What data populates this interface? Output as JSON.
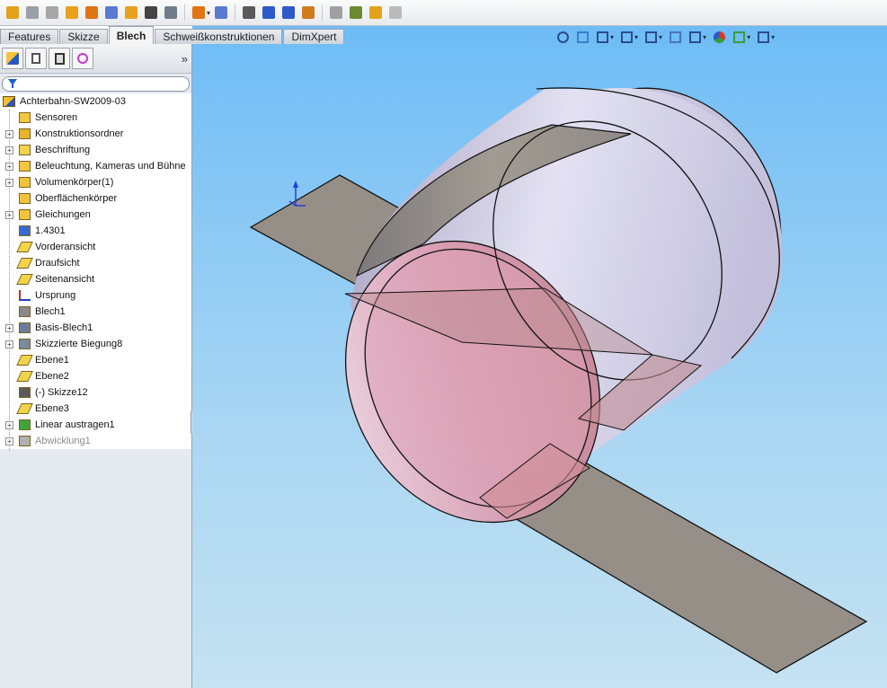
{
  "toolbar": {
    "icons": [
      "sheet-metal-base-icon",
      "convert-to-sheet-metal-icon",
      "lofted-bend-icon",
      "edge-flange-icon",
      "miter-flange-icon",
      "hem-icon",
      "sketched-bend-icon",
      "jog-icon",
      "cross-break-icon",
      "corner-icon",
      "corner-dropdown-icon",
      "closed-corner-icon",
      "forming-tool-icon",
      "unfold-icon",
      "fold-icon",
      "flatten-icon",
      "no-bends-icon",
      "rip-icon",
      "insert-bends-icon",
      "vent-icon"
    ]
  },
  "tabs": [
    "Features",
    "Skizze",
    "Blech",
    "Schweißkonstruktionen",
    "DimXpert"
  ],
  "active_tab": "Blech",
  "panel": {
    "more_glyph": "»",
    "tree": {
      "root": "Achterbahn-SW2009-03",
      "items": [
        {
          "label": "Sensoren",
          "expandable": false,
          "icon": "sensor-icon",
          "disabled": false
        },
        {
          "label": "Konstruktionsordner",
          "expandable": true,
          "icon": "design-binder-icon",
          "disabled": false
        },
        {
          "label": "Beschriftung",
          "expandable": true,
          "icon": "annotations-icon",
          "disabled": false
        },
        {
          "label": "Beleuchtung, Kameras und Bühne",
          "expandable": true,
          "icon": "lights-cameras-icon",
          "disabled": false
        },
        {
          "label": "Volumenkörper(1)",
          "expandable": true,
          "icon": "solid-bodies-icon",
          "disabled": false
        },
        {
          "label": "Oberflächenkörper",
          "expandable": false,
          "icon": "surface-bodies-icon",
          "disabled": false
        },
        {
          "label": "Gleichungen",
          "expandable": true,
          "icon": "equations-icon",
          "disabled": false
        },
        {
          "label": "1.4301",
          "expandable": false,
          "icon": "material-icon",
          "disabled": false
        },
        {
          "label": "Vorderansicht",
          "expandable": false,
          "icon": "plane-icon",
          "disabled": false
        },
        {
          "label": "Draufsicht",
          "expandable": false,
          "icon": "plane-icon",
          "disabled": false
        },
        {
          "label": "Seitenansicht",
          "expandable": false,
          "icon": "plane-icon",
          "disabled": false
        },
        {
          "label": "Ursprung",
          "expandable": false,
          "icon": "origin-icon",
          "disabled": false
        },
        {
          "label": "Blech1",
          "expandable": false,
          "icon": "sheet-metal-icon",
          "disabled": false
        },
        {
          "label": "Basis-Blech1",
          "expandable": true,
          "icon": "base-flange-icon",
          "disabled": false
        },
        {
          "label": "Skizzierte Biegung8",
          "expandable": true,
          "icon": "sketched-bend-icon",
          "disabled": false
        },
        {
          "label": "Ebene1",
          "expandable": false,
          "icon": "plane-icon",
          "disabled": false
        },
        {
          "label": "Ebene2",
          "expandable": false,
          "icon": "plane-icon",
          "disabled": false
        },
        {
          "label": "(-) Skizze12",
          "expandable": false,
          "icon": "sketch-icon",
          "disabled": false
        },
        {
          "label": "Ebene3",
          "expandable": false,
          "icon": "plane-icon",
          "disabled": false
        },
        {
          "label": "Linear austragen1",
          "expandable": true,
          "icon": "linear-pattern-icon",
          "disabled": false
        },
        {
          "label": "Abwicklung1",
          "expandable": true,
          "icon": "flat-pattern-icon",
          "disabled": true
        }
      ]
    }
  },
  "heads_up_toolbar": [
    "zoom-to-fit-icon",
    "zoom-area-icon",
    "previous-view-icon",
    "section-view-icon",
    "view-orientation-icon",
    "display-style-icon",
    "hide-show-items-icon",
    "edit-appearance-icon",
    "apply-scene-icon",
    "view-settings-icon"
  ],
  "colors": {
    "viewport_top": "#6ebcf6",
    "viewport_bottom": "#c5e2f2",
    "strip": "#958f87",
    "cylinder_outer": "#c9c6de",
    "cylinder_inner": "#e7b6c6",
    "axis_blue": "#1e3fe0"
  }
}
